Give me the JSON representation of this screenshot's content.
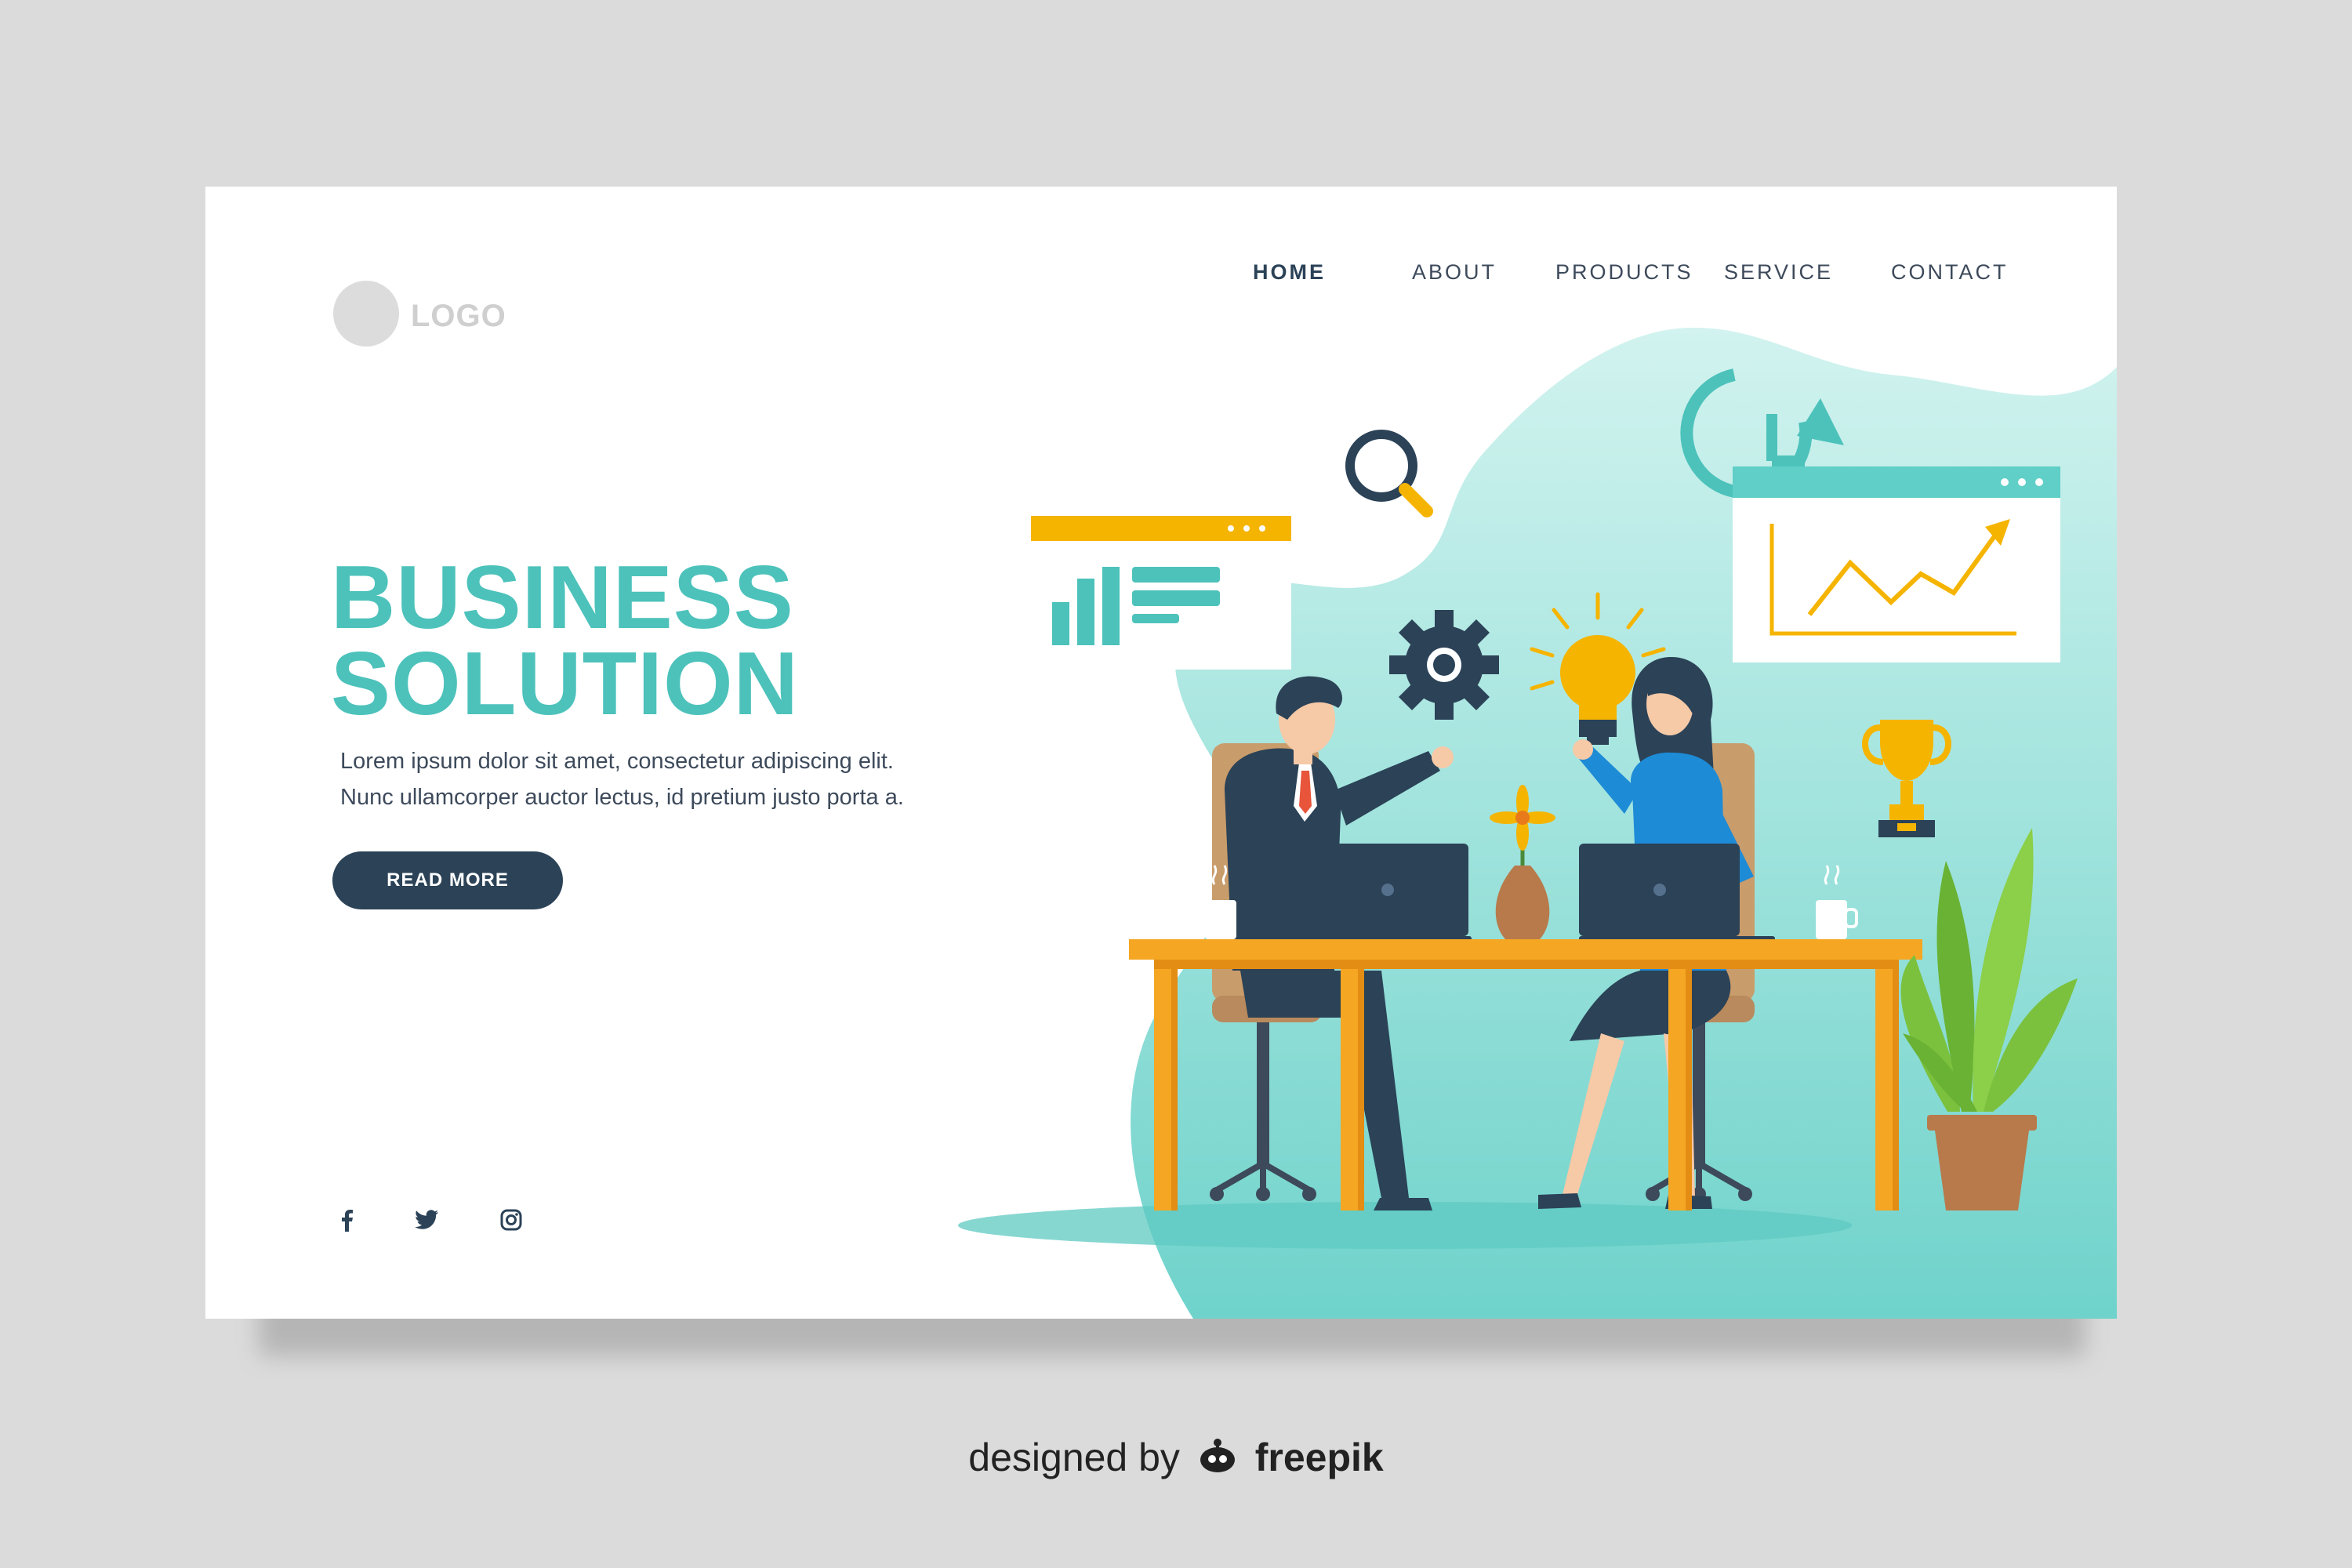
{
  "logo": {
    "text": "LOGO"
  },
  "nav": {
    "items": [
      {
        "label": "HOME",
        "active": true
      },
      {
        "label": "ABOUT",
        "active": false
      },
      {
        "label": "PRODUCTS",
        "active": false
      },
      {
        "label": "SERVICE",
        "active": false
      },
      {
        "label": "CONTACT",
        "active": false
      }
    ]
  },
  "hero": {
    "title_line1": "BUSINESS",
    "title_line2": "SOLUTION",
    "subtitle_line1": "Lorem ipsum dolor sit amet, consectetur adipiscing elit.",
    "subtitle_line2": "Nunc ullamcorper auctor lectus, id pretium justo porta a.",
    "cta_label": "READ MORE"
  },
  "social": {
    "icons": [
      "facebook-icon",
      "twitter-icon",
      "instagram-icon"
    ]
  },
  "credit": {
    "prefix": "designed by",
    "brand": "freepik"
  },
  "colors": {
    "accent_teal": "#4cc2bb",
    "navy": "#2b4257",
    "nav_text": "#3d4a5b",
    "orange": "#f5a623",
    "blob_light": "#c9f0ec",
    "blob_dark": "#76d6cf"
  }
}
